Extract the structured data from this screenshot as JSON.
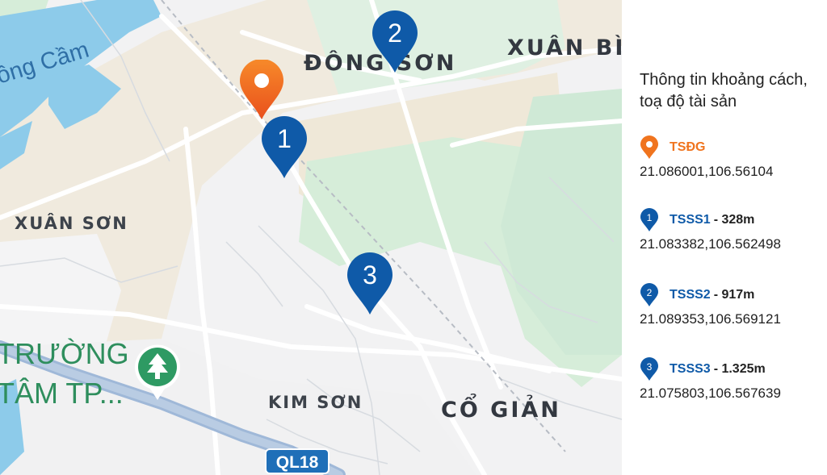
{
  "map": {
    "places": {
      "dong_son": "ĐÔNG SƠN",
      "xuan_binh": "XUÂN BÌ",
      "xuan_son": "XUÂN SƠN",
      "kim_son": "KIM SƠN",
      "co_gian": "CỔ GIẢN",
      "truong_line1": "TRƯỜNG",
      "truong_line2": "TÂM TP..."
    },
    "water_label": "ông Cầm",
    "road_shield": "QL18",
    "markers": {
      "main": "",
      "m1": "1",
      "m2": "2",
      "m3": "3"
    },
    "colors": {
      "orange": "#f0741e",
      "blue": "#0f5aa8",
      "water": "#8dcbea",
      "park": "#cfe9d6"
    }
  },
  "panel": {
    "title": "Thông tin khoảng cách, toạ độ tài sản",
    "entries": [
      {
        "icon": "orange-pin-icon",
        "name": "TSĐG",
        "distance": "",
        "coords": "21.086001,106.56104",
        "color": "#f0741e"
      },
      {
        "icon": "blue-pin-1-icon",
        "number": "1",
        "name": "TSSS1",
        "distance": "- 328m",
        "coords": "21.083382,106.562498",
        "color": "#0f5aa8"
      },
      {
        "icon": "blue-pin-2-icon",
        "number": "2",
        "name": "TSSS2",
        "distance": "- 917m",
        "coords": "21.089353,106.569121",
        "color": "#0f5aa8"
      },
      {
        "icon": "blue-pin-3-icon",
        "number": "3",
        "name": "TSSS3",
        "distance": "- 1.325m",
        "coords": "21.075803,106.567639",
        "color": "#0f5aa8"
      }
    ]
  }
}
